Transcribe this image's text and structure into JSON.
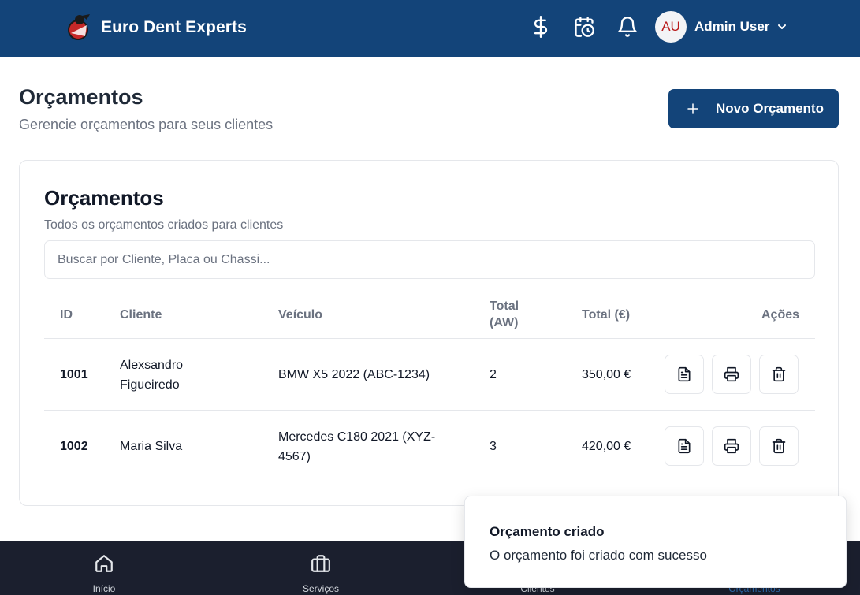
{
  "header": {
    "brand": "Euro Dent Experts",
    "avatar_initials": "AU",
    "user_name": "Admin User",
    "icons": [
      "dollar-icon",
      "calendar-clock-icon",
      "bell-icon",
      "chevron-down-icon"
    ]
  },
  "page": {
    "title": "Orçamentos",
    "subtitle": "Gerencie orçamentos para seus clientes",
    "new_button": "Novo Orçamento"
  },
  "card": {
    "title": "Orçamentos",
    "subtitle": "Todos os orçamentos criados para clientes",
    "search_placeholder": "Buscar por Cliente, Placa ou Chassi..."
  },
  "table": {
    "columns": {
      "id": "ID",
      "cliente": "Cliente",
      "veiculo": "Veículo",
      "total_aw_1": "Total",
      "total_aw_2": "(AW)",
      "total_eur": "Total (€)",
      "acoes": "Ações"
    },
    "rows": [
      {
        "id": "1001",
        "cliente_1": "Alexsandro",
        "cliente_2": "Figueiredo",
        "veiculo_1": "BMW X5 2022 (ABC-1234)",
        "veiculo_2": "",
        "total_aw": "2",
        "total_eur": "350,00 €"
      },
      {
        "id": "1002",
        "cliente_1": "Maria Silva",
        "cliente_2": "",
        "veiculo_1": "Mercedes C180 2021 (XYZ-",
        "veiculo_2": "4567)",
        "total_aw": "3",
        "total_eur": "420,00 €"
      }
    ],
    "action_icons": [
      "document-icon",
      "printer-icon",
      "trash-icon"
    ]
  },
  "nav": {
    "items": [
      {
        "label": "Início",
        "icon": "home-icon"
      },
      {
        "label": "Serviços",
        "icon": "briefcase-icon"
      },
      {
        "label": "Clientes",
        "icon": "users-icon"
      },
      {
        "label": "Orçamentos",
        "icon": "document-icon"
      }
    ],
    "active": "Orçamentos"
  },
  "toast": {
    "title": "Orçamento criado",
    "message": "O orçamento foi criado com sucesso"
  },
  "colors": {
    "primary": "#134479",
    "nav_bg": "#1b1f2e",
    "nav_active": "#2f6fb5",
    "avatar_text": "#b91c1c"
  }
}
